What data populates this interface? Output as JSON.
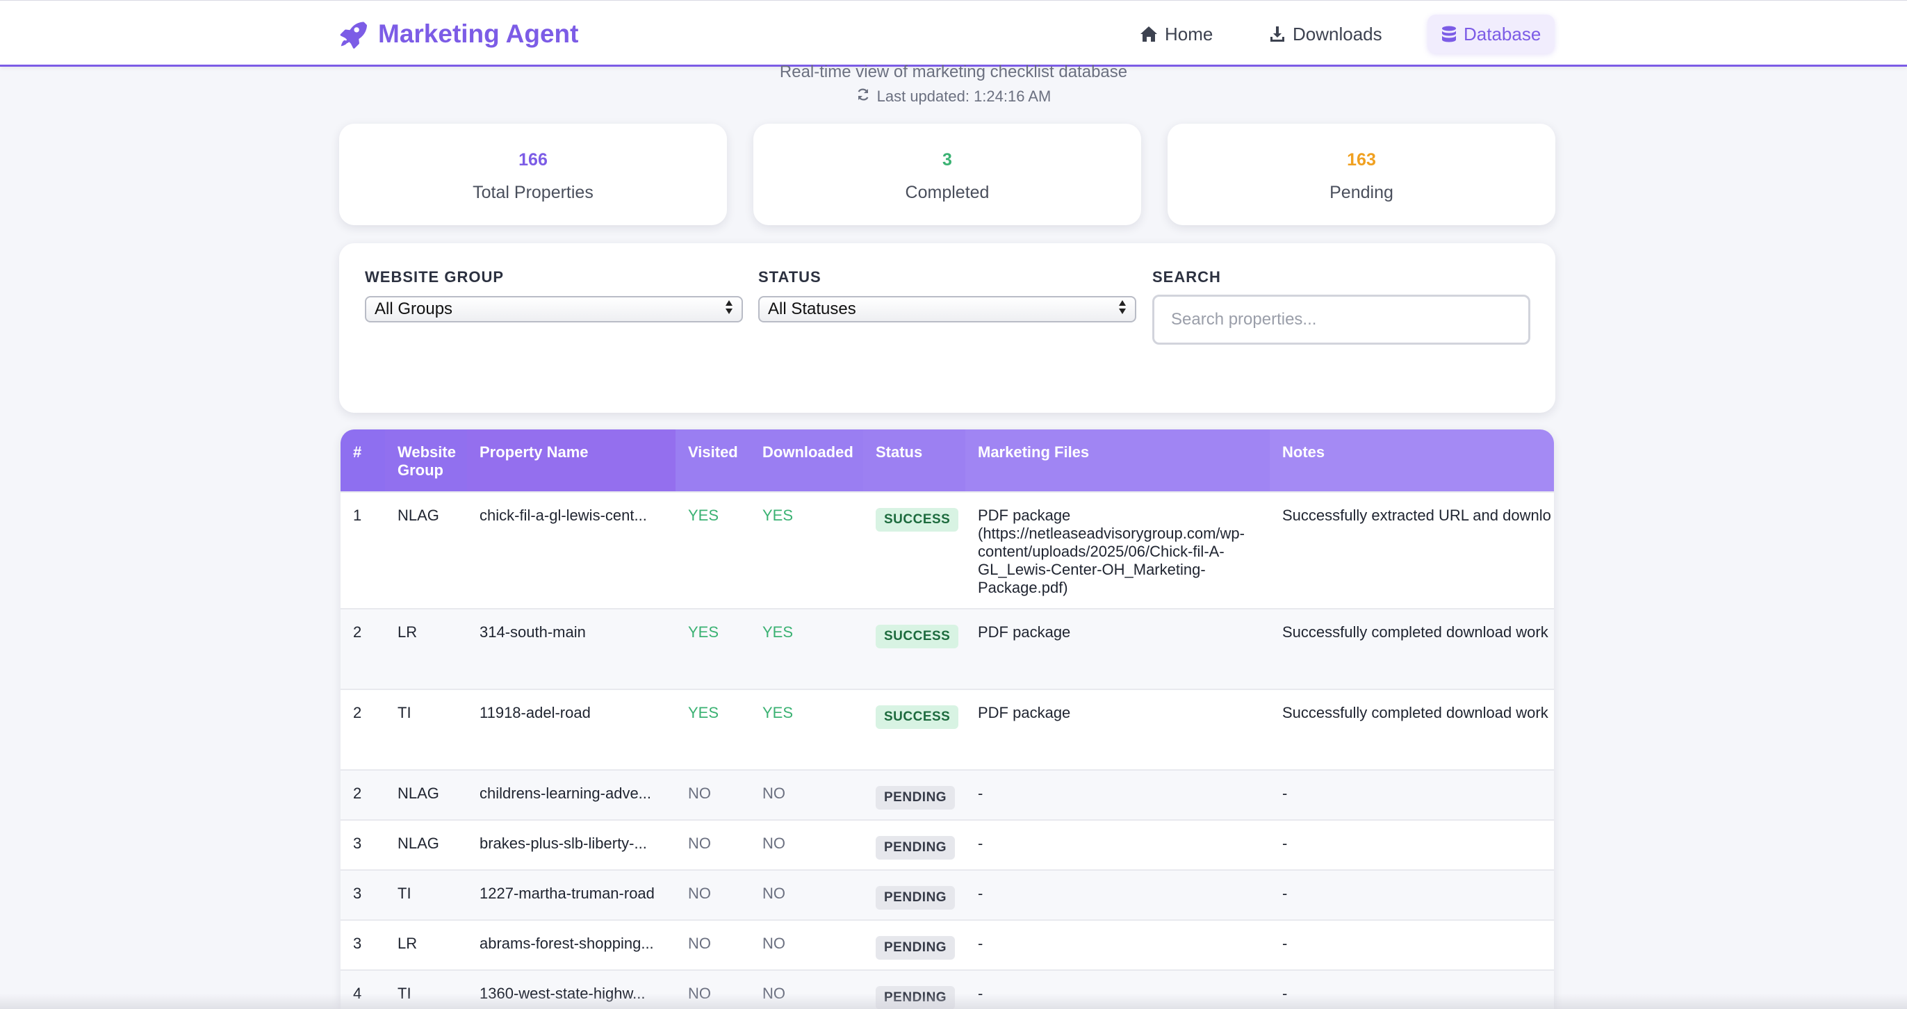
{
  "brand": {
    "title": "Marketing Agent",
    "icon": "rocket-icon",
    "accent": "#7c5ce6"
  },
  "nav": [
    {
      "label": "Home",
      "icon": "home-icon"
    },
    {
      "label": "Downloads",
      "icon": "download-icon"
    },
    {
      "label": "Database",
      "icon": "database-icon",
      "active": true
    }
  ],
  "header": {
    "subtitle": "Real-time view of marketing checklist database",
    "updated": "Last updated: 1:24:16 AM"
  },
  "stats": [
    {
      "value": "166",
      "label": "Total Properties",
      "color": "#7c5ce6"
    },
    {
      "value": "3",
      "label": "Completed",
      "color": "#3bb273"
    },
    {
      "value": "163",
      "label": "Pending",
      "color": "#f0a020"
    }
  ],
  "filters": {
    "group_label": "WEBSITE GROUP",
    "group_value": "All Groups",
    "status_label": "STATUS",
    "status_value": "All Statuses",
    "search_label": "SEARCH",
    "search_placeholder": "Search properties..."
  },
  "table": {
    "columns": [
      "#",
      "Website Group",
      "Property Name",
      "Visited",
      "Downloaded",
      "Status",
      "Marketing Files",
      "Notes"
    ],
    "rows": [
      {
        "num": "1",
        "group": "NLAG",
        "name": "chick-fil-a-gl-lewis-cent...",
        "visited": "YES",
        "downloaded": "YES",
        "status": "SUCCESS",
        "files": "PDF package (https://netleaseadvisorygroup.com/wp-content/uploads/2025/06/Chick-fil-A-GL_Lewis-Center-OH_Marketing-Package.pdf)",
        "notes": "Successfully extracted URL and downlo"
      },
      {
        "num": "2",
        "group": "LR",
        "name": "314-south-main",
        "visited": "YES",
        "downloaded": "YES",
        "status": "SUCCESS",
        "files": "PDF package",
        "notes": "Successfully completed download work"
      },
      {
        "num": "2",
        "group": "TI",
        "name": "11918-adel-road",
        "visited": "YES",
        "downloaded": "YES",
        "status": "SUCCESS",
        "files": "PDF package",
        "notes": "Successfully completed download work"
      },
      {
        "num": "2",
        "group": "NLAG",
        "name": "childrens-learning-adve...",
        "visited": "NO",
        "downloaded": "NO",
        "status": "PENDING",
        "files": "-",
        "notes": "-"
      },
      {
        "num": "3",
        "group": "NLAG",
        "name": "brakes-plus-slb-liberty-...",
        "visited": "NO",
        "downloaded": "NO",
        "status": "PENDING",
        "files": "-",
        "notes": "-"
      },
      {
        "num": "3",
        "group": "TI",
        "name": "1227-martha-truman-road",
        "visited": "NO",
        "downloaded": "NO",
        "status": "PENDING",
        "files": "-",
        "notes": "-"
      },
      {
        "num": "3",
        "group": "LR",
        "name": "abrams-forest-shopping...",
        "visited": "NO",
        "downloaded": "NO",
        "status": "PENDING",
        "files": "-",
        "notes": "-"
      },
      {
        "num": "4",
        "group": "TI",
        "name": "1360-west-state-highw...",
        "visited": "NO",
        "downloaded": "NO",
        "status": "PENDING",
        "files": "-",
        "notes": "-"
      }
    ]
  }
}
